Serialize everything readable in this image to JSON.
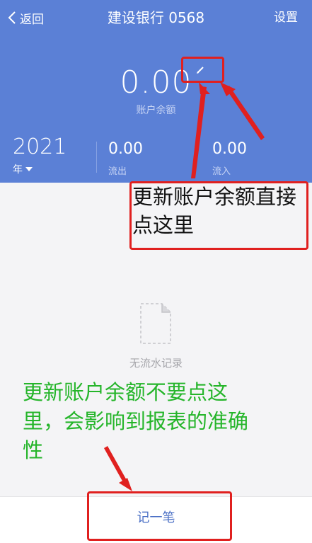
{
  "header": {
    "back_label": "返回",
    "title": "建设银行 0568",
    "settings_label": "设置",
    "balance": "0.00",
    "balance_label": "账户余额"
  },
  "summary": {
    "year": "2021",
    "year_unit": "年",
    "outflow_value": "0.00",
    "outflow_label": "流出",
    "inflow_value": "0.00",
    "inflow_label": "流入"
  },
  "empty_state": {
    "text": "无流水记录"
  },
  "bottom": {
    "record_label": "记一笔"
  },
  "annotations": {
    "edit_tip": "更新账户余额直接点这里",
    "warn_tip": "更新账户余额不要点这里，会影响到报表的准确性"
  },
  "colors": {
    "header_bg": "#5b80d6",
    "annotation_red": "#e0201f",
    "annotation_green": "#25b52a",
    "accent_blue": "#4a6fc5"
  }
}
